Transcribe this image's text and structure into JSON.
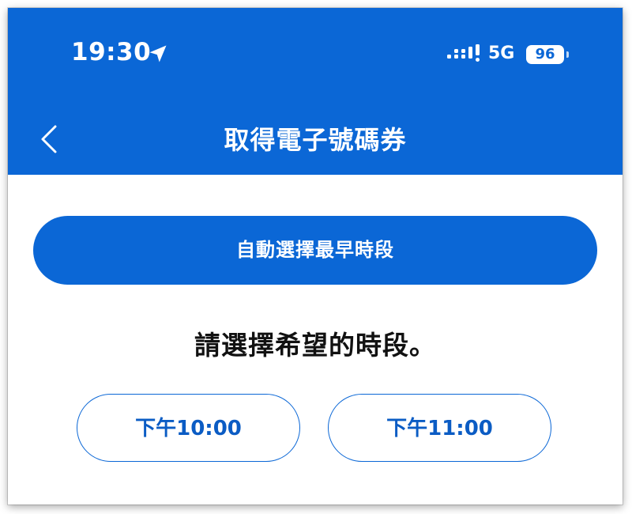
{
  "status_bar": {
    "time": "19:30",
    "network": "5G",
    "battery": "96",
    "location_icon": "location-arrow-icon",
    "signal_icon": "cellular-signal-icon"
  },
  "nav": {
    "back_icon": "chevron-left-icon",
    "title": "取得電子號碼券"
  },
  "main": {
    "auto_select_label": "自動選擇最早時段",
    "prompt": "請選擇希望的時段。",
    "time_slots": [
      {
        "label": "下午10:00"
      },
      {
        "label": "下午11:00"
      }
    ]
  },
  "colors": {
    "primary": "#0b67d6",
    "background": "#ffffff",
    "text": "#111111"
  }
}
